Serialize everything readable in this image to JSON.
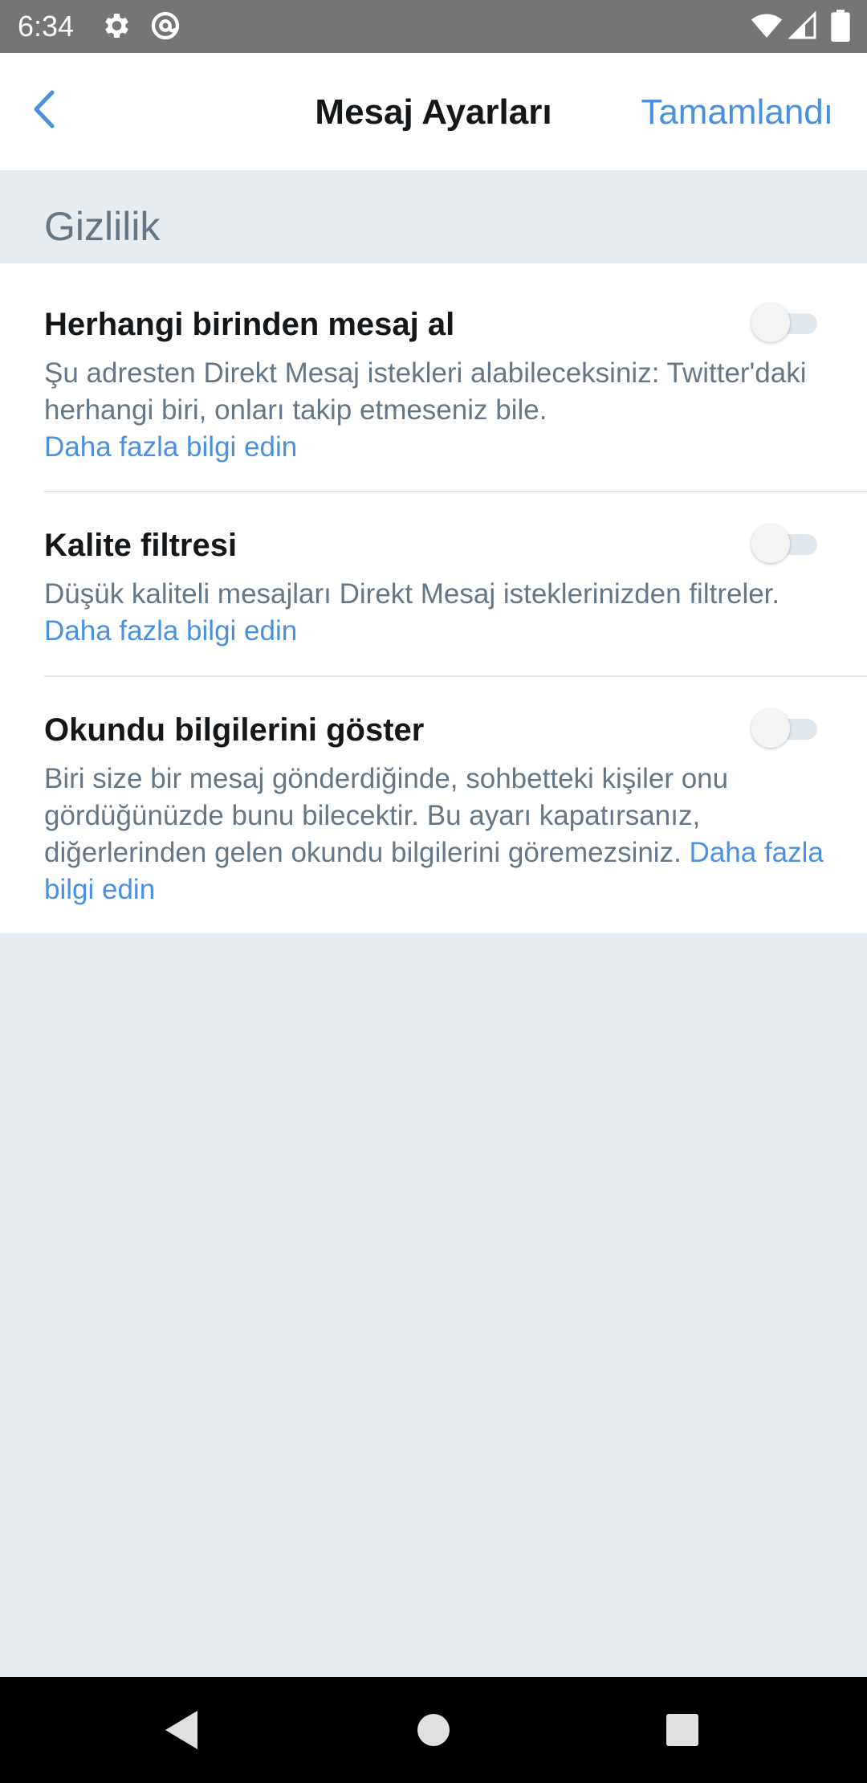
{
  "status_bar": {
    "time": "6:34",
    "left_icons": [
      "gear-icon",
      "at-sign-icon"
    ],
    "right_icons": [
      "wifi-icon",
      "signal-icon",
      "battery-icon"
    ]
  },
  "header": {
    "back_icon": "chevron-left-icon",
    "title": "Mesaj Ayarları",
    "done_label": "Tamamlandı"
  },
  "section": {
    "title": "Gizlilik"
  },
  "settings": [
    {
      "title": "Herhangi birinden mesaj al",
      "description": "Şu adresten Direkt Mesaj istekleri alabileceksiniz: Twitter'daki herhangi biri, onları takip etmeseniz bile.",
      "link": "Daha fazla bilgi edin",
      "enabled": false
    },
    {
      "title": "Kalite filtresi",
      "description": "Düşük kaliteli mesajları Direkt Mesaj isteklerinizden filtreler.",
      "link": "Daha fazla bilgi edin",
      "enabled": false
    },
    {
      "title": "Okundu bilgilerini göster",
      "description": "Biri size bir mesaj gönderdiğinde, sohbetteki kişiler onu gördüğünüzde bunu bilecektir. Bu ayarı kapatırsanız, diğerlerinden gelen okundu bilgilerini göremezsiniz.",
      "link": "Daha fazla bilgi edin",
      "enabled": false
    }
  ],
  "nav_bar": {
    "buttons": [
      "back-triangle-icon",
      "home-circle-icon",
      "recents-square-icon"
    ]
  },
  "colors": {
    "accent": "#4a90e2",
    "title_text": "#14171a",
    "secondary_text": "#657786",
    "background": "#e6ecf0",
    "status_bar": "#757575"
  }
}
